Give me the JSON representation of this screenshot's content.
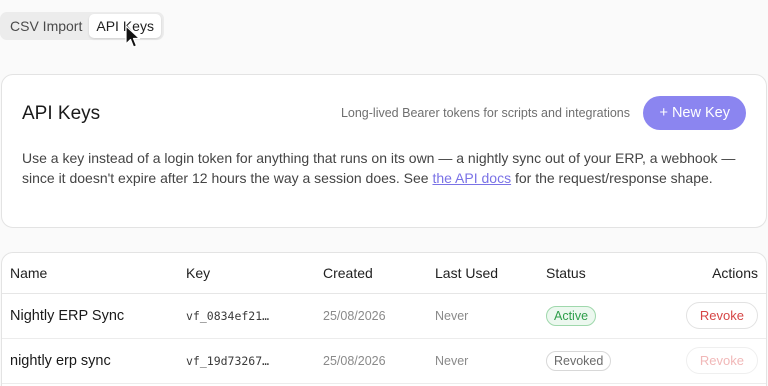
{
  "tabs": [
    {
      "label": "CSV Import",
      "active": false
    },
    {
      "label": "API Keys",
      "active": true
    }
  ],
  "card": {
    "title": "API Keys",
    "hint": "Long-lived Bearer tokens for scripts and integrations",
    "new_key_label": "+ New Key",
    "desc_before": "Use a key instead of a login token for anything that runs on its own — a nightly sync out of your ERP, a webhook — since it doesn't expire after 12 hours the way a session does. See ",
    "desc_link": "the API docs",
    "desc_after": " for the request/response shape."
  },
  "table": {
    "headers": {
      "name": "Name",
      "key": "Key",
      "created": "Created",
      "last_used": "Last Used",
      "status": "Status",
      "actions": "Actions"
    },
    "rows": [
      {
        "name": "Nightly ERP Sync",
        "key": "vf_0834ef21…",
        "created": "25/08/2026",
        "last_used": "Never",
        "status": "Active",
        "action": "Revoke"
      },
      {
        "name": "nightly erp sync",
        "key": "vf_19d73267…",
        "created": "25/08/2026",
        "last_used": "Never",
        "status": "Revoked",
        "action": "Revoke"
      }
    ]
  },
  "colors": {
    "accent": "#8b85f0",
    "active_status": "#2e9e4a",
    "revoke": "#d64545"
  },
  "icons": {
    "cursor": "mouse-pointer-icon"
  }
}
